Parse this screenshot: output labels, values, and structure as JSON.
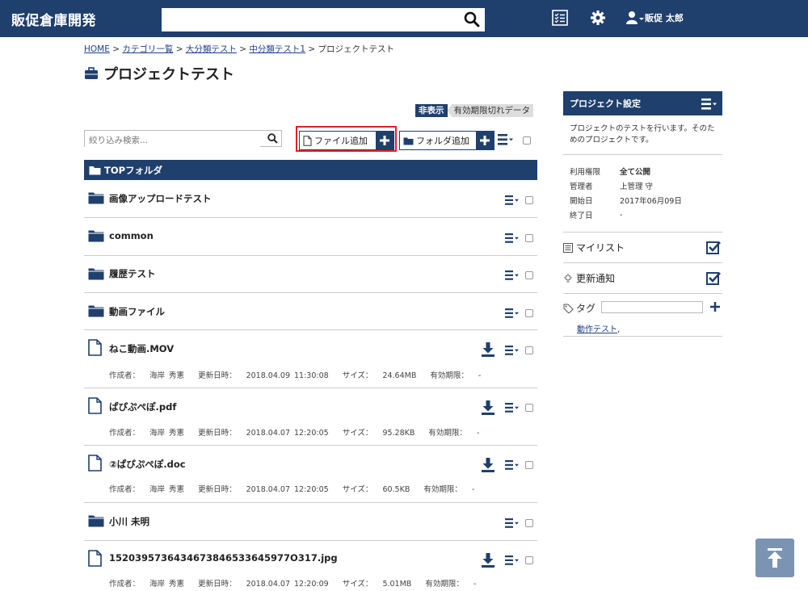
{
  "app": {
    "title": "販促倉庫開発"
  },
  "search": {
    "placeholder": ""
  },
  "user": {
    "name": "販促 太郎"
  },
  "breadcrumb": {
    "home": "HOME",
    "sep": ">",
    "category": "カテゴリ一覧",
    "large": "大分類テスト",
    "middle": "中分類テスト1",
    "current": "プロジェクトテスト"
  },
  "page": {
    "title": "プロジェクトテスト"
  },
  "toggle": {
    "on": "非表示",
    "off": "有効期限切れデータ"
  },
  "filter": {
    "placeholder": "絞り込み検索..."
  },
  "toolbar": {
    "add_file": "ファイル追加",
    "add_folder": "フォルダ追加"
  },
  "top_folder": {
    "label": "TOPフォルダ"
  },
  "meta_labels": {
    "author": "作成者：",
    "updated": "更新日時：",
    "size": "サイズ：",
    "expiry": "有効期限："
  },
  "rows": [
    {
      "type": "folder",
      "name": "画像アップロードテスト"
    },
    {
      "type": "folder",
      "name": "common"
    },
    {
      "type": "folder",
      "name": "履歴テスト"
    },
    {
      "type": "folder",
      "name": "動画ファイル"
    },
    {
      "type": "file",
      "name": "ねこ動画.MOV",
      "author": "海岸 秀憲",
      "updated": "2018.04.09 11:30:08",
      "size": "24.64MB",
      "expiry": "-"
    },
    {
      "type": "file",
      "name": "ぱぴぷぺぽ.pdf",
      "author": "海岸 秀憲",
      "updated": "2018.04.07 12:20:05",
      "size": "95.28KB",
      "expiry": "-"
    },
    {
      "type": "file",
      "name": "②ぱぴぷぺぽ.doc",
      "author": "海岸 秀憲",
      "updated": "2018.04.07 12:20:05",
      "size": "60.5KB",
      "expiry": "-"
    },
    {
      "type": "folder",
      "name": "小川 未明"
    },
    {
      "type": "file",
      "name": "1520395736434673846533645977O317.jpg",
      "author": "海岸 秀憲",
      "updated": "2018.04.07 12:20:09",
      "size": "5.01MB",
      "expiry": "-"
    }
  ],
  "sidebar": {
    "title": "プロジェクト設定",
    "description": "プロジェクトのテストを行います。そのためのプロジェクトです。",
    "props": [
      {
        "k": "利用権限",
        "v": "全て公開"
      },
      {
        "k": "管理者",
        "v": "上管理 守"
      },
      {
        "k": "開始日",
        "v": "2017年06月09日"
      },
      {
        "k": "終了日",
        "v": "-"
      }
    ],
    "mylist": "マイリスト",
    "notify": "更新通知",
    "tag_label": "タグ",
    "tag_link": "動作テスト"
  },
  "colors": {
    "navy": "#1f3f6d",
    "highlight": "#e21d2c",
    "totop": "#7c94b3"
  }
}
